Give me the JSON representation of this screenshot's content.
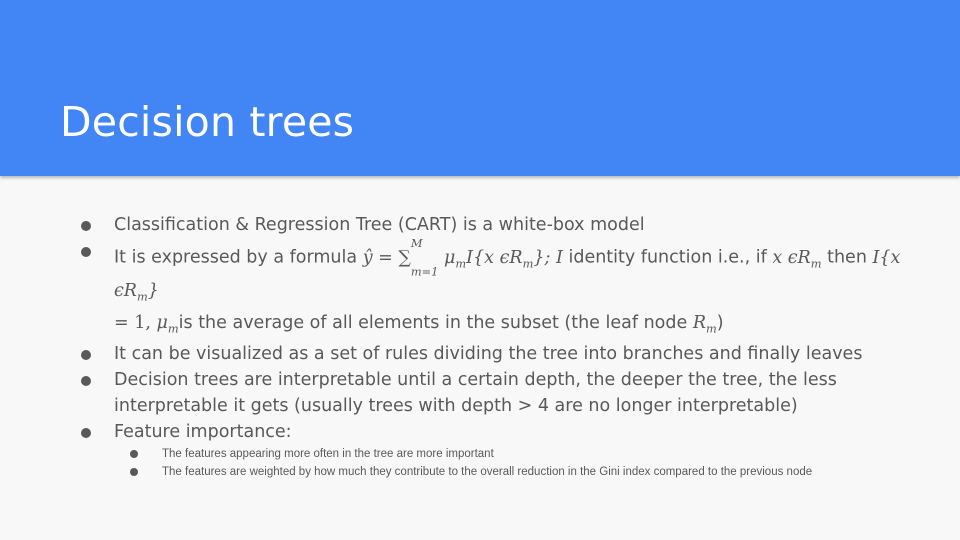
{
  "slide": {
    "title": "Decision trees",
    "bullets": [
      {
        "text": "Classification & Regression Tree (CART) is a white-box model"
      },
      {
        "text_a": "It is expressed by a formula",
        "formula_y": "ŷ = ∑",
        "formula_sub": "m=1",
        "formula_sup": "M",
        "formula_b": "μ",
        "formula_b_sub": "m",
        "formula_c": "I{x ϵR",
        "formula_c_sub": "m",
        "formula_c_end": "};",
        "formula_I": "I",
        "text_b": " identity function i.e., if ",
        "cond": "x ϵR",
        "cond_sub": "m",
        "text_c": " then ",
        "cond2": "I{x ϵR",
        "cond2_sub": "m",
        "cond2_end": "}",
        "eq": "= 1, ",
        "mu": "μ",
        "mu_sub": "m",
        "text_d": "is the average of all elements in the subset (the leaf node ",
        "leaf": "R",
        "leaf_sub": "m",
        "text_e": ")"
      },
      {
        "text": "It can be visualized as a set of rules dividing the tree into branches and finally leaves"
      },
      {
        "text": "Decision trees are interpretable until a certain depth, the deeper the tree, the less interpretable it gets (usually trees with depth > 4 are no longer interpretable)"
      },
      {
        "text": "Feature importance:"
      }
    ],
    "sub_bullets": [
      {
        "text": "The features appearing more often in the tree are more important"
      },
      {
        "text": "The features are weighted by how much they contribute to the overall reduction in the Gini index compared to the previous node"
      }
    ]
  }
}
